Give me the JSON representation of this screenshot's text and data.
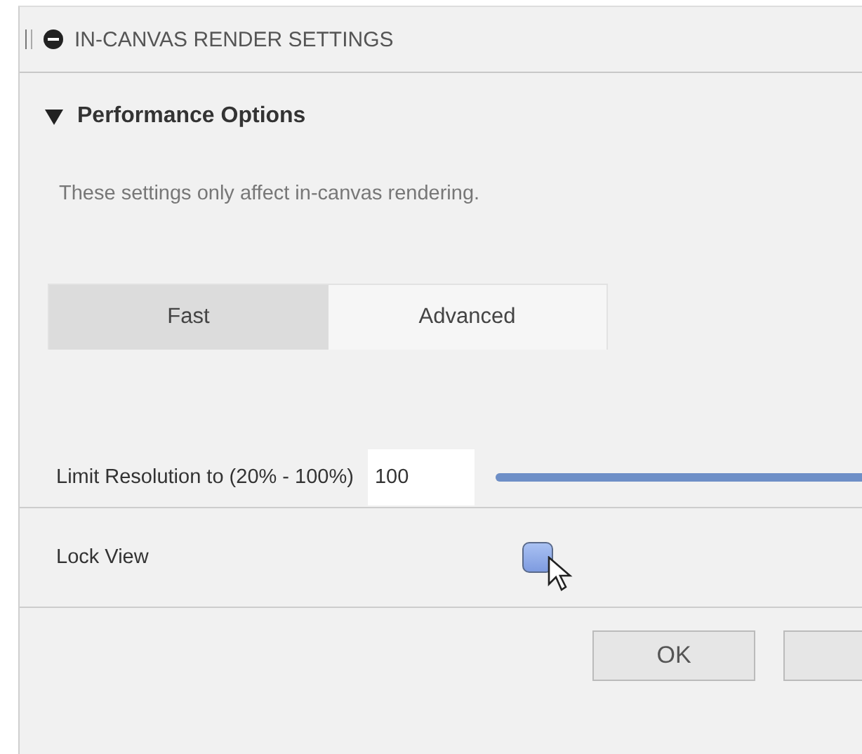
{
  "panel": {
    "title": "IN-CANVAS RENDER SETTINGS"
  },
  "section": {
    "title": "Performance Options",
    "expanded": true,
    "description": "These settings only affect in-canvas rendering."
  },
  "tabs": [
    {
      "label": "Fast",
      "selected": true
    },
    {
      "label": "Advanced",
      "selected": false
    }
  ],
  "resolution": {
    "label": "Limit Resolution to (20% - 100%)",
    "value": "100",
    "level": 1
  },
  "lock_view": {
    "label": "Lock View",
    "checked": false
  },
  "buttons": [
    "OK"
  ]
}
